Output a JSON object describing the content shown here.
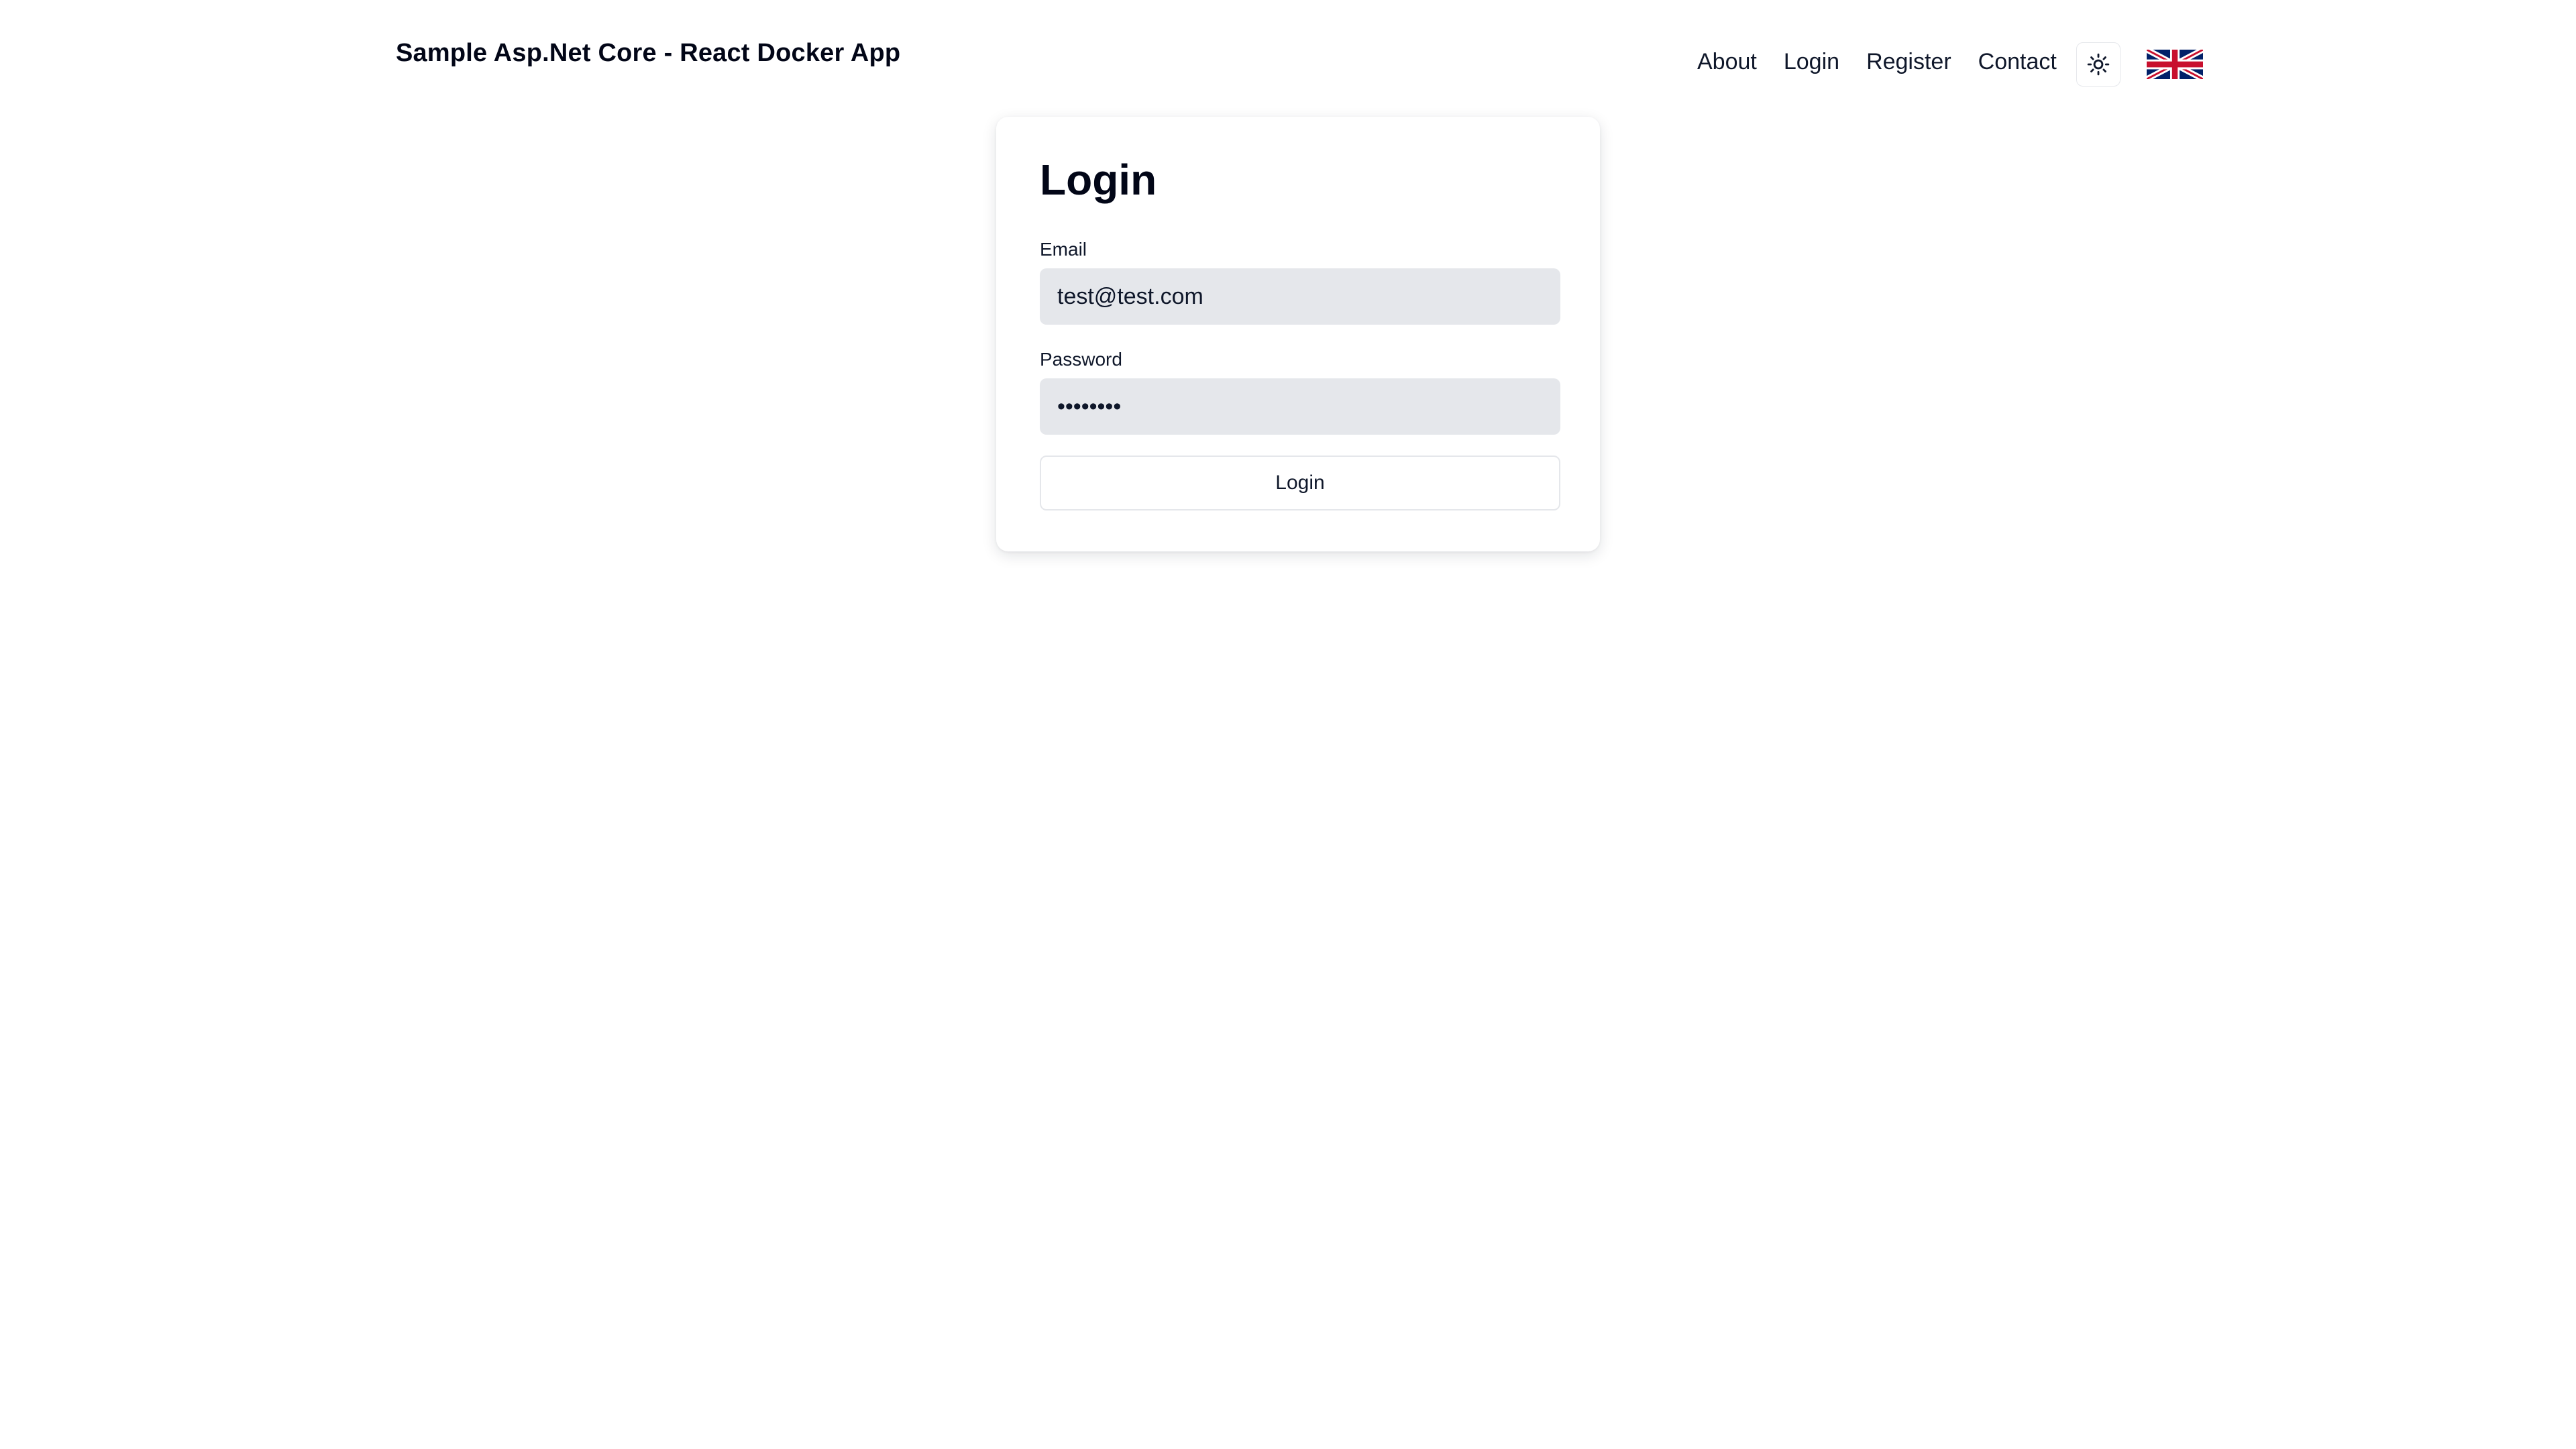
{
  "navbar": {
    "brand": "Sample Asp.Net Core - React Docker App",
    "links": [
      {
        "label": "About"
      },
      {
        "label": "Login"
      },
      {
        "label": "Register"
      },
      {
        "label": "Contact"
      }
    ],
    "theme_toggle_icon": "sun-icon",
    "language_flag_icon": "uk-flag-icon"
  },
  "login_form": {
    "title": "Login",
    "email": {
      "label": "Email",
      "value": "test@test.com"
    },
    "password": {
      "label": "Password",
      "value": "password"
    },
    "submit_label": "Login"
  },
  "colors": {
    "input_background": "#e5e7eb",
    "text": "#0f172a",
    "flag_blue": "#012169",
    "flag_red": "#C8102E"
  }
}
